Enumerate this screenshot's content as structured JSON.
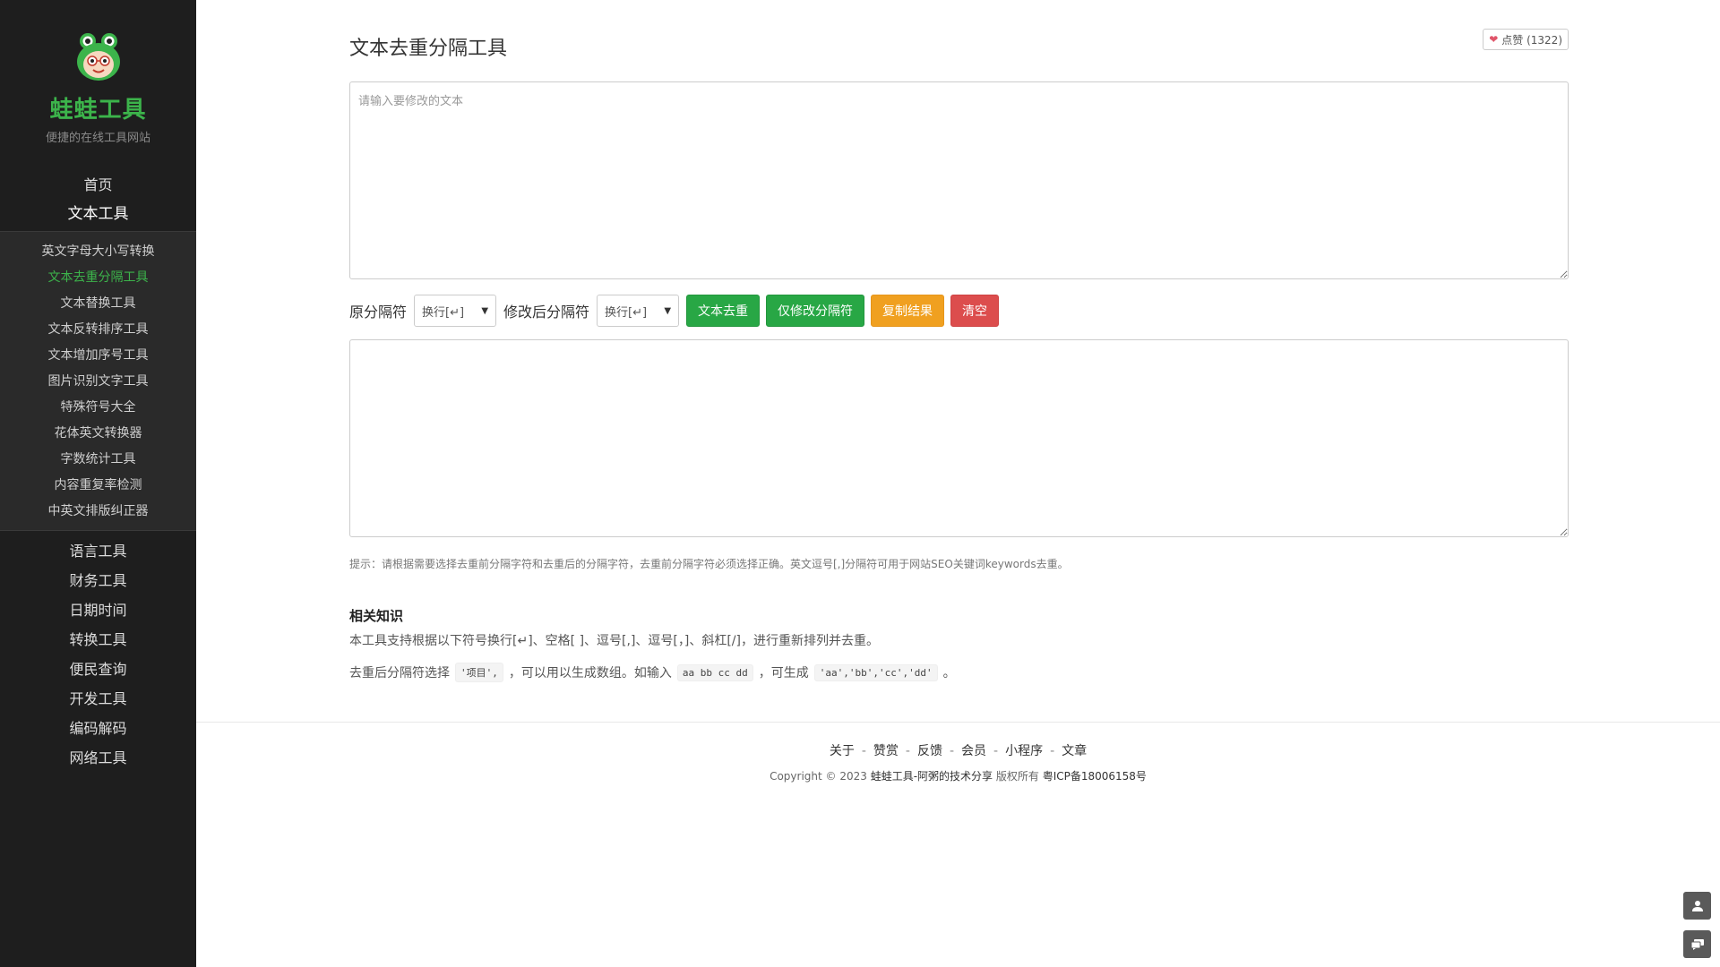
{
  "brand": {
    "name": "蛙蛙工具",
    "tagline": "便捷的在线工具网站",
    "accent": "#3cb44b"
  },
  "sidebar": {
    "top_items": [
      {
        "label": "首页"
      },
      {
        "label": "文本工具"
      }
    ],
    "sub_items": [
      {
        "label": "英文字母大小写转换"
      },
      {
        "label": "文本去重分隔工具"
      },
      {
        "label": "文本替换工具"
      },
      {
        "label": "文本反转排序工具"
      },
      {
        "label": "文本增加序号工具"
      },
      {
        "label": "图片识别文字工具"
      },
      {
        "label": "特殊符号大全"
      },
      {
        "label": "花体英文转换器"
      },
      {
        "label": "字数统计工具"
      },
      {
        "label": "内容重复率检测"
      },
      {
        "label": "中英文排版纠正器"
      }
    ],
    "bottom_items": [
      {
        "label": "语言工具"
      },
      {
        "label": "财务工具"
      },
      {
        "label": "日期时间"
      },
      {
        "label": "转换工具"
      },
      {
        "label": "便民查询"
      },
      {
        "label": "开发工具"
      },
      {
        "label": "编码解码"
      },
      {
        "label": "网络工具"
      }
    ]
  },
  "page": {
    "title": "文本去重分隔工具",
    "like_label": "点赞 (1322)"
  },
  "input": {
    "placeholder": "请输入要修改的文本",
    "value": ""
  },
  "toolbar": {
    "orig_sep_label": "原分隔符",
    "orig_sep_value": "换行[↵]",
    "new_sep_label": "修改后分隔符",
    "new_sep_value": "换行[↵]",
    "dedupe_label": "文本去重",
    "only_sep_label": "仅修改分隔符",
    "copy_label": "复制结果",
    "clear_label": "清空"
  },
  "output": {
    "value": ""
  },
  "hint": "提示：请根据需要选择去重前分隔字符和去重后的分隔字符，去重前分隔字符必须选择正确。英文逗号[,]分隔符可用于网站SEO关键词keywords去重。",
  "knowledge": {
    "title": "相关知识",
    "p1": "本工具支持根据以下符号换行[↵]、空格[ ]、逗号[,]、逗号[，]、斜杠[/]，进行重新排列并去重。",
    "p2_a": "去重后分隔符选择",
    "p2_code1": "'项目',",
    "p2_b": "，可以用以生成数组。如输入",
    "p2_code2": "aa bb cc dd",
    "p2_c": "，可生成",
    "p2_code3": "'aa','bb','cc','dd'",
    "p2_d": "。"
  },
  "footer": {
    "links": [
      "关于",
      "赞赏",
      "反馈",
      "会员",
      "小程序",
      "文章"
    ],
    "copyright_prefix": "Copyright © 2023 ",
    "copyright_site": "蛙蛙工具-阿粥的技术分享",
    "copyright_mid": " 版权所有 ",
    "icp": "粤ICP备18006158号"
  },
  "colors": {
    "sidebar_bg": "#1e1e1e",
    "green": "#28a745",
    "orange": "#f0a020",
    "red": "#dc4d4d"
  }
}
